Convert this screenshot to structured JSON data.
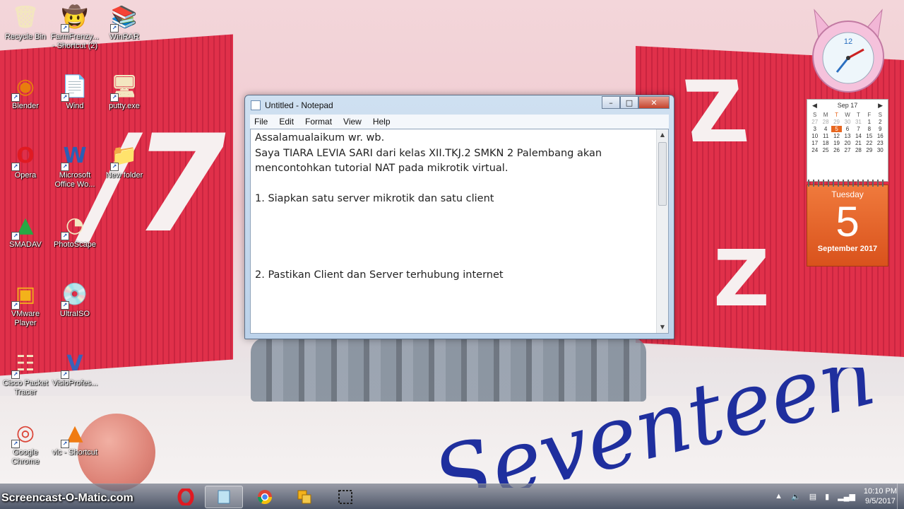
{
  "desktop_icons": [
    {
      "label": "Recycle Bin",
      "icon": "recycle-bin-icon"
    },
    {
      "label": "FarmFrenzy... - Shortcut (2)",
      "icon": "farm-frenzy-icon"
    },
    {
      "label": "WinRAR",
      "icon": "winrar-icon"
    },
    {
      "label": "Blender",
      "icon": "blender-icon"
    },
    {
      "label": "Wind",
      "icon": "document-icon"
    },
    {
      "label": "putty.exe",
      "icon": "putty-icon"
    },
    {
      "label": "Opera",
      "icon": "opera-icon"
    },
    {
      "label": "Microsoft Office Wo...",
      "icon": "word-icon"
    },
    {
      "label": "New folder",
      "icon": "folder-icon"
    },
    {
      "label": "SMADAV",
      "icon": "smadav-icon"
    },
    {
      "label": "PhotoScape",
      "icon": "photoscape-icon"
    },
    {
      "label": "VMware Player",
      "icon": "vmware-icon"
    },
    {
      "label": "UltraISO",
      "icon": "ultraiso-icon"
    },
    {
      "label": "Cisco Packet Tracer",
      "icon": "cisco-icon"
    },
    {
      "label": "VisioProfes...",
      "icon": "visio-icon"
    },
    {
      "label": "Google Chrome",
      "icon": "chrome-icon"
    },
    {
      "label": "vlc - Shortcut",
      "icon": "vlc-icon"
    }
  ],
  "notepad": {
    "title": "Untitled - Notepad",
    "menu": [
      "File",
      "Edit",
      "Format",
      "View",
      "Help"
    ],
    "lines": [
      "Assalamualaikum wr. wb.",
      "Saya TIARA LEVIA SARI dari kelas XII.TKJ.2 SMKN 2 Palembang akan",
      "mencontohkan tutorial NAT pada mikrotik virtual.",
      "",
      "1. Siapkan satu server mikrotik dan satu client",
      "",
      "",
      "",
      "",
      "2. Pastikan Client dan Server terhubung internet"
    ]
  },
  "calendar": {
    "month_label": "Sep 17",
    "weekday_headers": [
      "S",
      "M",
      "T",
      "W",
      "T",
      "F",
      "S"
    ],
    "weeks": [
      [
        "27",
        "28",
        "29",
        "30",
        "31",
        "1",
        "2"
      ],
      [
        "3",
        "4",
        "5",
        "6",
        "7",
        "8",
        "9"
      ],
      [
        "10",
        "11",
        "12",
        "13",
        "14",
        "15",
        "16"
      ],
      [
        "17",
        "18",
        "19",
        "20",
        "21",
        "22",
        "23"
      ],
      [
        "24",
        "25",
        "26",
        "27",
        "28",
        "29",
        "30"
      ]
    ],
    "today": "5",
    "weekday": "Tuesday",
    "day": "5",
    "month_year": "September 2017"
  },
  "clock": {
    "label": "12"
  },
  "wallpaper": {
    "logo_text": "Seventeen"
  },
  "taskbar": {
    "watermark": "Screencast-O-Matic.com",
    "time": "10:10 PM",
    "date": "9/5/2017"
  },
  "colors": {
    "accent": "#e8661f",
    "wall_red": "#e0304a",
    "logo_blue": "#1f2f9e"
  }
}
